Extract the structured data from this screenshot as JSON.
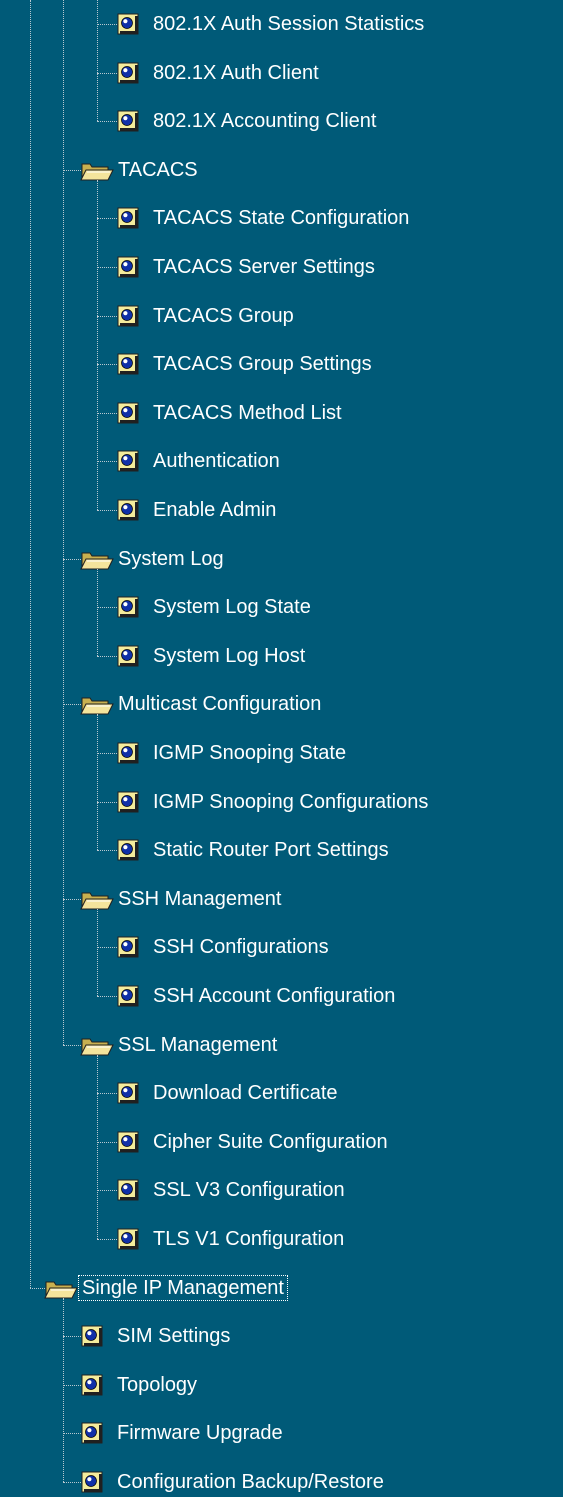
{
  "colors": {
    "background": "#005a78",
    "text": "#ffffff",
    "page_icon": "#f4ec9c",
    "folder_icon": "#f4e49c"
  },
  "groups": [
    {
      "label": null,
      "items": [
        "802.1X Auth Session Statistics",
        "802.1X Auth Client",
        "802.1X Accounting Client"
      ]
    },
    {
      "label": "TACACS",
      "items": [
        "TACACS State Configuration",
        "TACACS Server Settings",
        "TACACS Group",
        "TACACS Group Settings",
        "TACACS Method List",
        "Authentication",
        "Enable Admin"
      ]
    },
    {
      "label": "System Log",
      "items": [
        "System Log State",
        "System Log Host"
      ]
    },
    {
      "label": "Multicast Configuration",
      "items": [
        "IGMP Snooping State",
        "IGMP Snooping Configurations",
        "Static Router Port Settings"
      ]
    },
    {
      "label": "SSH Management",
      "items": [
        "SSH Configurations",
        "SSH Account Configuration"
      ]
    },
    {
      "label": "SSL Management",
      "items": [
        "Download Certificate",
        "Cipher Suite Configuration",
        "SSL V3 Configuration",
        "TLS V1 Configuration"
      ]
    }
  ],
  "top_group": {
    "label": "Single IP Management",
    "items": [
      "SIM Settings",
      "Topology",
      "Firmware Upgrade",
      "Configuration Backup/Restore"
    ]
  },
  "icons": {
    "folder": "open-folder-icon",
    "page": "document-page-icon"
  }
}
